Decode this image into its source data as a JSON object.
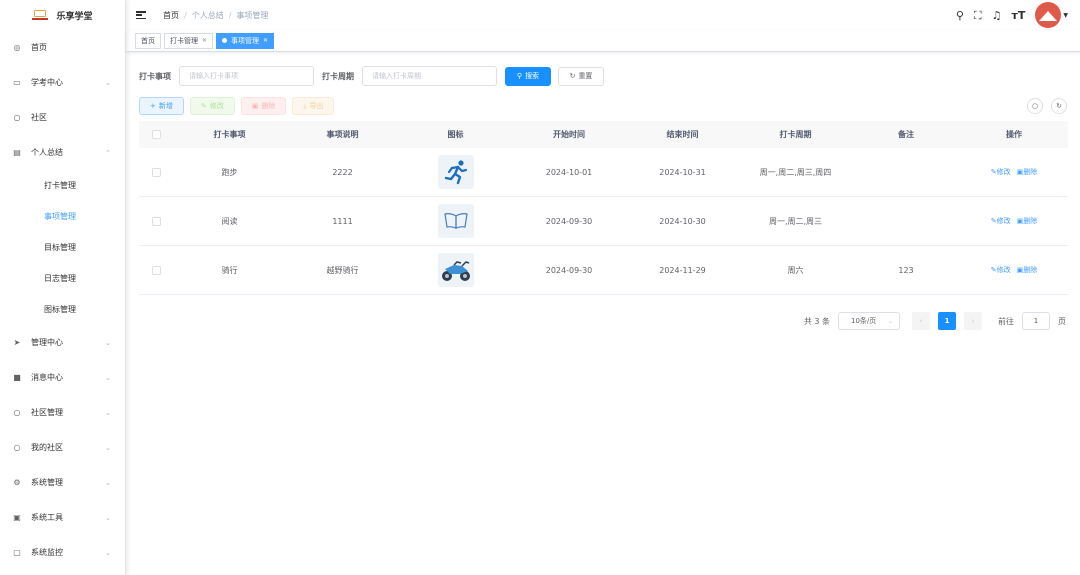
{
  "app": {
    "title": "乐享学堂"
  },
  "sidebar": {
    "items": [
      {
        "label": "首页",
        "icon": "dashboard-icon",
        "has_children": false
      },
      {
        "label": "学考中心",
        "icon": "monitor-icon",
        "has_children": true
      },
      {
        "label": "社区",
        "icon": "community-icon",
        "has_children": false
      },
      {
        "label": "个人总结",
        "icon": "document-icon",
        "has_children": true,
        "expanded": true,
        "children": [
          {
            "label": "打卡管理",
            "active": false
          },
          {
            "label": "事项管理",
            "active": true
          },
          {
            "label": "目标管理",
            "active": false
          },
          {
            "label": "日志管理",
            "active": false
          },
          {
            "label": "图标管理",
            "active": false
          }
        ]
      },
      {
        "label": "管理中心",
        "icon": "send-icon",
        "has_children": true
      },
      {
        "label": "消息中心",
        "icon": "message-icon",
        "has_children": true
      },
      {
        "label": "社区管理",
        "icon": "community-manage-icon",
        "has_children": true
      },
      {
        "label": "我的社区",
        "icon": "my-community-icon",
        "has_children": true
      },
      {
        "label": "系统管理",
        "icon": "settings-icon",
        "has_children": true
      },
      {
        "label": "系统工具",
        "icon": "tools-icon",
        "has_children": true
      },
      {
        "label": "系统监控",
        "icon": "monitor-screen-icon",
        "has_children": true
      }
    ]
  },
  "header": {
    "breadcrumb": [
      "首页",
      "个人总结",
      "事项管理"
    ]
  },
  "tags": [
    {
      "label": "首页",
      "active": false,
      "closable": false
    },
    {
      "label": "打卡管理",
      "active": false,
      "closable": true
    },
    {
      "label": "事项管理",
      "active": true,
      "closable": true
    }
  ],
  "search": {
    "item_label": "打卡事项",
    "item_placeholder": "请输入打卡事项",
    "period_label": "打卡周期",
    "period_placeholder": "请输入打卡周期",
    "search_button": "搜索",
    "reset_button": "重置"
  },
  "toolbar": {
    "add": "新增",
    "edit": "修改",
    "delete": "删除",
    "export": "导出"
  },
  "table": {
    "columns": [
      "打卡事项",
      "事项说明",
      "图标",
      "开始时间",
      "结束时间",
      "打卡周期",
      "备注",
      "操作"
    ],
    "rows": [
      {
        "name": "跑步",
        "desc": "2222",
        "icon": "running-icon",
        "start": "2024-10-01",
        "end": "2024-10-31",
        "period": "周一,周二,周三,周四",
        "remark": ""
      },
      {
        "name": "阅读",
        "desc": "1111",
        "icon": "book-icon",
        "start": "2024-09-30",
        "end": "2024-10-30",
        "period": "周一,周二,周三",
        "remark": ""
      },
      {
        "name": "骑行",
        "desc": "越野骑行",
        "icon": "motorcycle-icon",
        "start": "2024-09-30",
        "end": "2024-11-29",
        "period": "周六",
        "remark": "123"
      }
    ],
    "row_actions": {
      "edit": "修改",
      "delete": "删除"
    }
  },
  "pagination": {
    "total_text": "共 3 条",
    "page_size": "10条/页",
    "current_page": "1",
    "goto_label": "前往",
    "goto_value": "1",
    "page_suffix": "页"
  },
  "colors": {
    "primary": "#1890ff",
    "link": "#409eff"
  }
}
